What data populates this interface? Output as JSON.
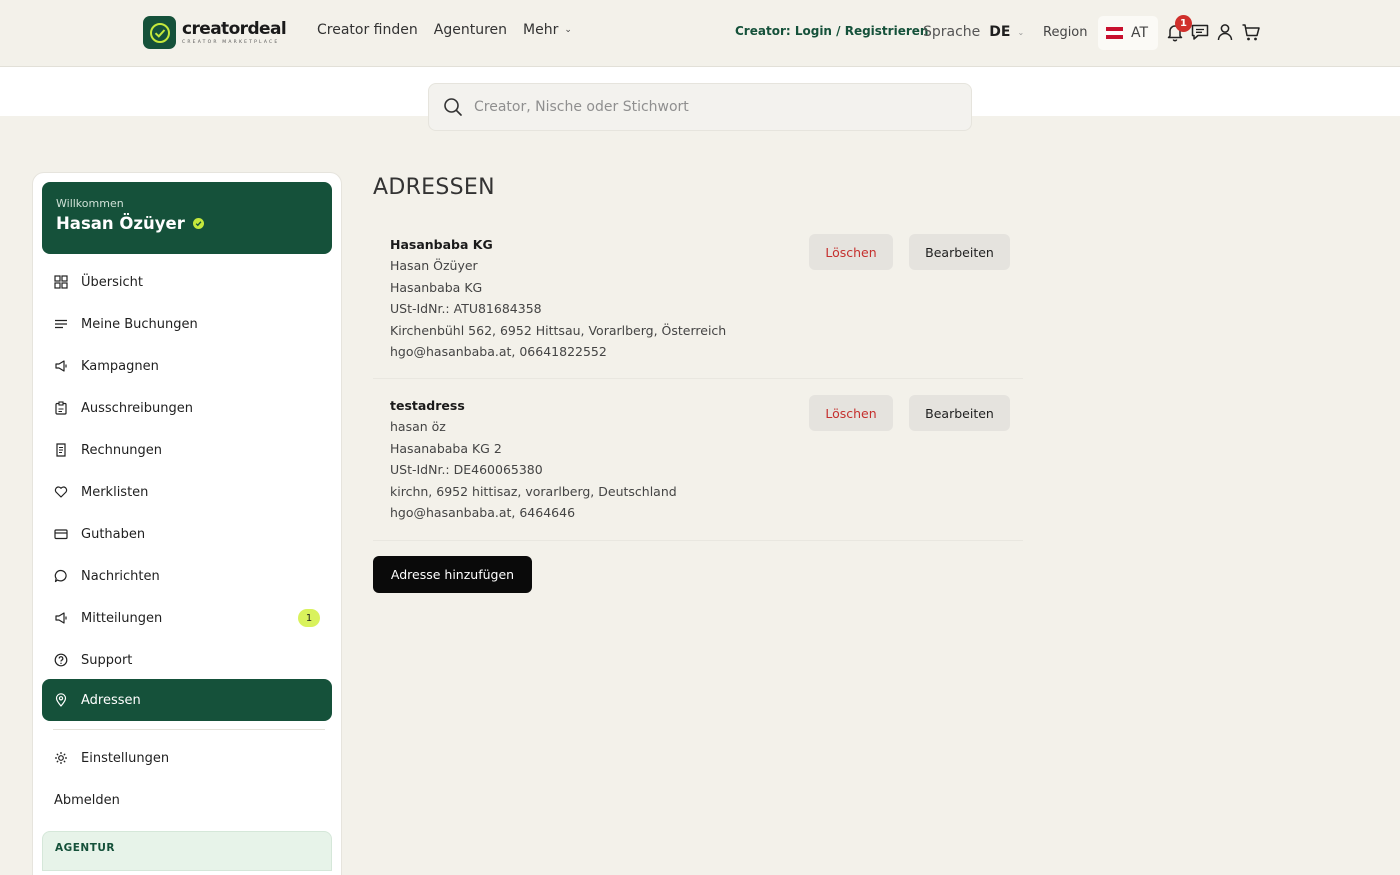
{
  "brand": {
    "name": "creatordeal",
    "tagline": "CREATOR MARKETPLACE",
    "accent": "#15513a"
  },
  "nav": {
    "items": [
      "Creator finden",
      "Agenturen",
      "Mehr"
    ]
  },
  "header": {
    "creator_login": "Creator: Login / Registrieren",
    "language_label": "Sprache",
    "language_value": "DE",
    "region_label": "Region",
    "country_code": "AT",
    "notification_count": "1"
  },
  "search": {
    "placeholder": "Creator, Nische oder Stichwort"
  },
  "sidebar": {
    "welcome": "Willkommen",
    "user_name": "Hasan Özüyer",
    "items": [
      {
        "label": "Übersicht",
        "icon": "grid-icon"
      },
      {
        "label": "Meine Buchungen",
        "icon": "list-icon"
      },
      {
        "label": "Kampagnen",
        "icon": "megaphone-icon"
      },
      {
        "label": "Ausschreibungen",
        "icon": "clipboard-icon"
      },
      {
        "label": "Rechnungen",
        "icon": "receipt-icon"
      },
      {
        "label": "Merklisten",
        "icon": "heart-icon"
      },
      {
        "label": "Guthaben",
        "icon": "card-icon"
      },
      {
        "label": "Nachrichten",
        "icon": "chat-icon"
      },
      {
        "label": "Mitteilungen",
        "icon": "megaphone-icon",
        "count": "1"
      },
      {
        "label": "Support",
        "icon": "help-icon"
      },
      {
        "label": "Adressen",
        "icon": "location-pin-icon",
        "active": true
      }
    ],
    "settings": "Einstellungen",
    "logout": "Abmelden",
    "agency_section": "AGENTUR"
  },
  "main": {
    "title": "ADRESSEN",
    "delete_label": "Löschen",
    "edit_label": "Bearbeiten",
    "add_label": "Adresse hinzufügen",
    "addresses": [
      {
        "lines": [
          "Hasanbaba KG",
          "Hasan Özüyer",
          "Hasanbaba KG",
          "USt-IdNr.: ATU81684358",
          "Kirchenbühl 562, 6952 Hittsau, Vorarlberg, Österreich",
          "hgo@hasanbaba.at, 06641822552"
        ]
      },
      {
        "lines": [
          "testadress",
          "hasan öz",
          "Hasanababa KG 2",
          "USt-IdNr.: DE460065380",
          "kirchn, 6952 hittisaz, vorarlberg, Deutschland",
          "hgo@hasanbaba.at, 6464646"
        ]
      }
    ]
  }
}
